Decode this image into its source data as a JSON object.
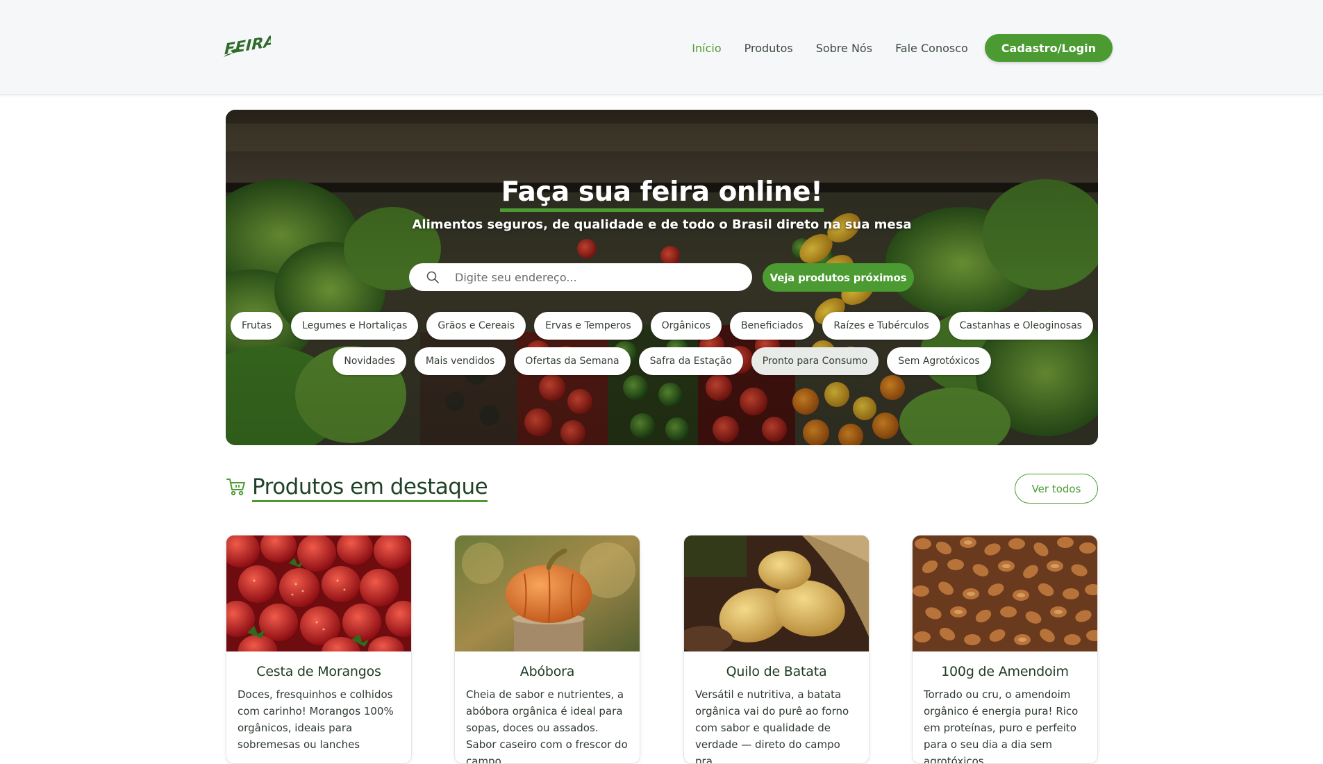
{
  "header": {
    "logo_text": "FEIRA",
    "nav": [
      "Início",
      "Produtos",
      "Sobre Nós",
      "Fale Conosco"
    ],
    "active_nav": "Início",
    "login_label": "Cadastro/Login"
  },
  "hero": {
    "title": "Faça sua feira online!",
    "subtitle": "Alimentos seguros, de qualidade e de todo o Brasil direto na sua mesa",
    "search_placeholder": "Digite seu endereço...",
    "cta_label": "Veja produtos próximos",
    "categories_row1": [
      "Frutas",
      "Legumes e Hortaliças",
      "Grãos e Cereais",
      "Ervas e Temperos",
      "Orgânicos",
      "Beneficiados",
      "Raízes e Tubérculos",
      "Castanhas e Oleoginosas"
    ],
    "categories_row2": [
      "Novidades",
      "Mais vendidos",
      "Ofertas da Semana",
      "Safra da Estação",
      "Pronto para Consumo",
      "Sem Agrotóxicos"
    ],
    "highlighted_chip": "Pronto para Consumo"
  },
  "featured": {
    "title": "Produtos em destaque",
    "see_all_label": "Ver todos",
    "products": [
      {
        "name": "Cesta de Morangos",
        "description": "Doces, fresquinhos e colhidos com carinho! Morangos 100% orgânicos, ideais para sobremesas ou lanches",
        "image": "strawberries"
      },
      {
        "name": "Abóbora",
        "description": "Cheia de sabor e nutrientes, a abóbora orgânica é ideal para sopas, doces ou assados. Sabor caseiro com o frescor do campo,",
        "image": "pumpkin"
      },
      {
        "name": "Quilo de Batata",
        "description": "Versátil e nutritiva, a batata orgânica vai do purê ao forno com sabor e qualidade de verdade — direto do campo pra",
        "image": "potatoes"
      },
      {
        "name": "100g de Amendoim",
        "description": "Torrado ou cru, o amendoim orgânico é energia pura! Rico em proteínas, puro e perfeito para o seu dia a dia sem agrotóxicos.",
        "image": "peanuts"
      }
    ]
  },
  "colors": {
    "brand_green": "#4b9b32",
    "dark_green": "#1f4326",
    "header_bg": "#f6f7f9"
  }
}
